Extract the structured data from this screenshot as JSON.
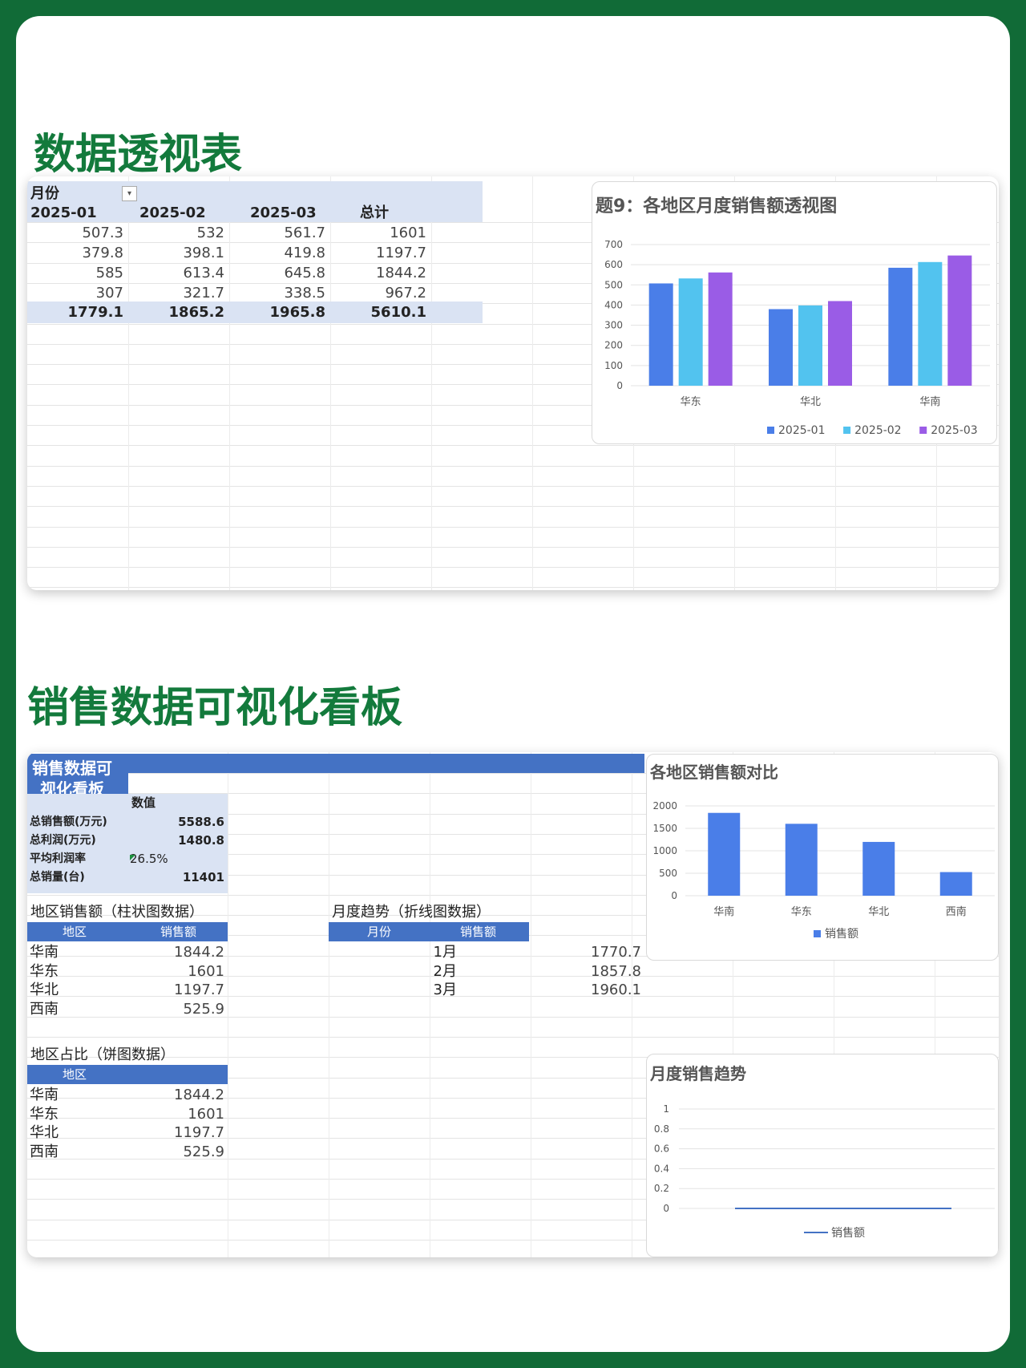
{
  "sections": {
    "pivot_title": "数据透视表",
    "dashboard_title": "销售数据可视化看板"
  },
  "pivot": {
    "header_label": "月份",
    "columns": [
      "2025-01",
      "2025-02",
      "2025-03",
      "总计"
    ],
    "rows": [
      [
        "507.3",
        "532",
        "561.7",
        "1601"
      ],
      [
        "379.8",
        "398.1",
        "419.8",
        "1197.7"
      ],
      [
        "585",
        "613.4",
        "645.8",
        "1844.2"
      ],
      [
        "307",
        "321.7",
        "338.5",
        "967.2"
      ]
    ],
    "totals": [
      "1779.1",
      "1865.2",
      "1965.8",
      "5610.1"
    ]
  },
  "dashboard": {
    "banner_line1": "销售数据可",
    "banner_line2": "视化看板",
    "kpi_header": "数值",
    "kpis": [
      {
        "label": "总销售额(万元)",
        "value": "5588.6"
      },
      {
        "label": "总利润(万元)",
        "value": "1480.8"
      },
      {
        "label": "平均利润率",
        "value": "26.5%"
      },
      {
        "label": "总销量(台)",
        "value": "11401"
      }
    ],
    "region_sales": {
      "title": "地区销售额（柱状图数据）",
      "col_region": "地区",
      "col_sales": "销售额",
      "rows": [
        [
          "华南",
          "1844.2"
        ],
        [
          "华东",
          "1601"
        ],
        [
          "华北",
          "1197.7"
        ],
        [
          "西南",
          "525.9"
        ]
      ]
    },
    "monthly_trend": {
      "title": "月度趋势（折线图数据）",
      "col_month": "月份",
      "col_sales": "销售额",
      "rows": [
        [
          "1月",
          "1770.7"
        ],
        [
          "2月",
          "1857.8"
        ],
        [
          "3月",
          "1960.1"
        ]
      ]
    },
    "region_share": {
      "title": "地区占比（饼图数据）",
      "col_region": "地区",
      "rows": [
        [
          "华南",
          "1844.2"
        ],
        [
          "华东",
          "1601"
        ],
        [
          "华北",
          "1197.7"
        ],
        [
          "西南",
          "525.9"
        ]
      ]
    }
  },
  "chart_data": [
    {
      "type": "bar",
      "title": "题9：各地区月度销售额透视图",
      "categories": [
        "华东",
        "华北",
        "华南"
      ],
      "series": [
        {
          "name": "2025-01",
          "values": [
            507.3,
            379.8,
            585
          ],
          "color": "#4a7ee8"
        },
        {
          "name": "2025-02",
          "values": [
            532,
            398.1,
            613.4
          ],
          "color": "#52c3ef"
        },
        {
          "name": "2025-03",
          "values": [
            561.7,
            419.8,
            645.8
          ],
          "color": "#9a5ce6"
        }
      ],
      "yticks": [
        "0",
        "100",
        "200",
        "300",
        "400",
        "500",
        "600",
        "700"
      ],
      "ylim": [
        0,
        700
      ],
      "legend": "bottom"
    },
    {
      "type": "bar",
      "title": "各地区销售额对比",
      "categories": [
        "华南",
        "华东",
        "华北",
        "西南"
      ],
      "series": [
        {
          "name": "销售额",
          "values": [
            1844.2,
            1601,
            1197.7,
            525.9
          ],
          "color": "#4a7ee8"
        }
      ],
      "yticks": [
        "0",
        "500",
        "1000",
        "1500",
        "2000"
      ],
      "ylim": [
        0,
        2000
      ],
      "legend": "bottom"
    },
    {
      "type": "line",
      "title": "月度销售趋势",
      "categories": [],
      "series": [
        {
          "name": "销售额",
          "values": [
            0,
            0,
            0
          ],
          "color": "#4472c4"
        }
      ],
      "yticks": [
        "0",
        "0.2",
        "0.4",
        "0.6",
        "0.8",
        "1"
      ],
      "ylim": [
        0,
        1
      ],
      "legend": "bottom"
    }
  ]
}
